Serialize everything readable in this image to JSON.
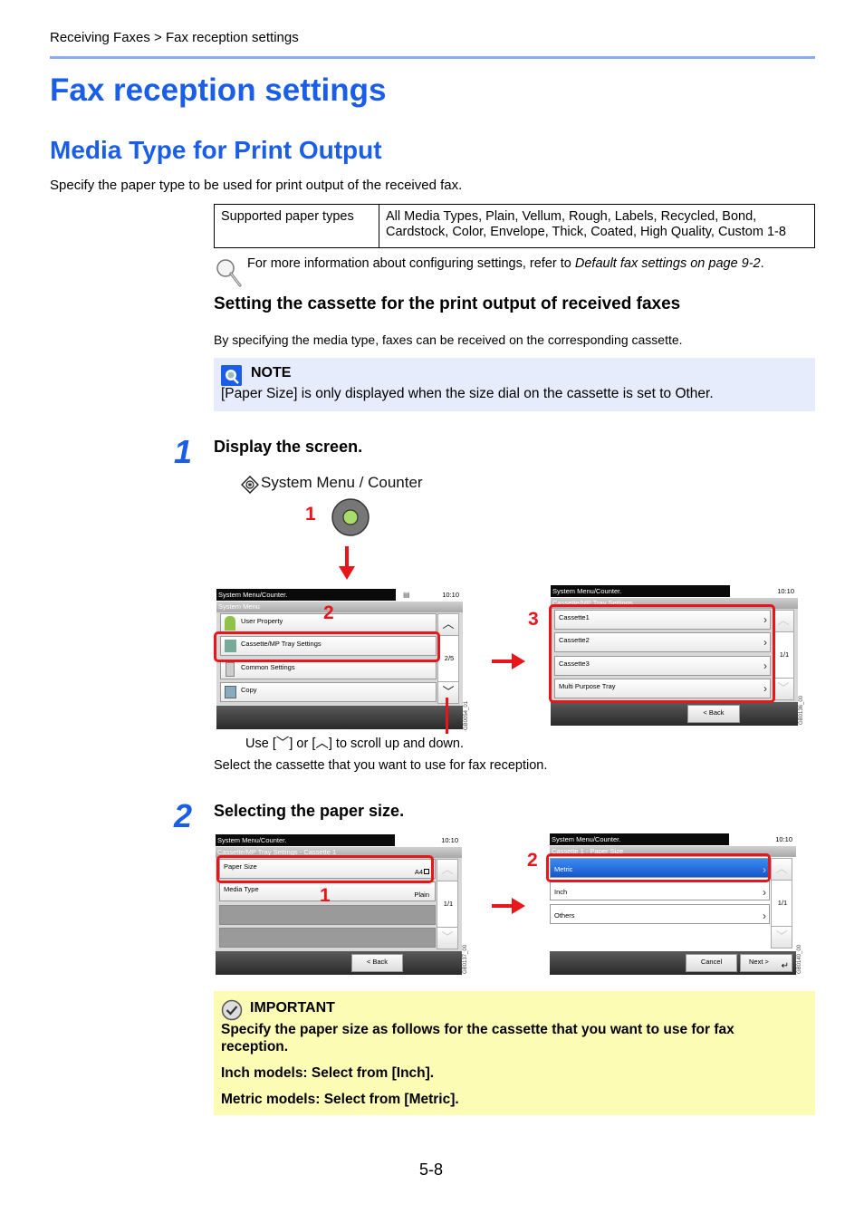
{
  "breadcrumb": "Receiving Faxes > Fax reception settings",
  "page_title": "Fax reception settings",
  "section_title": "Media Type for Print Output",
  "intro": "Specify the paper type to be used for print output of the received fax.",
  "spec_table": {
    "label": "Supported paper types",
    "value": "All Media Types, Plain, Vellum, Rough, Labels, Recycled, Bond, Cardstock, Color, Envelope, Thick, Coated, High Quality, Custom 1-8"
  },
  "reference": {
    "prefix": "For more information about configuring settings, refer to ",
    "link": "Default fax settings on page 9-2",
    "suffix": "."
  },
  "subsection_title": "Setting the cassette for the print output of received faxes",
  "subsection_intro": "By specifying the media type, faxes can be received on the corresponding cassette.",
  "note": {
    "title": "NOTE",
    "body": "[Paper Size] is only displayed when the size dial on the cassette is set to Other."
  },
  "steps": [
    {
      "number": "1",
      "heading": "Display the screen.",
      "key_label": "System Menu / Counter",
      "callouts": [
        "1",
        "2",
        "3"
      ],
      "scroll_caption": {
        "pre": "Use [",
        "mid": "] or [",
        "post": "] to scroll up and down."
      },
      "after_text": "Select the cassette that you want to use for fax reception.",
      "screen_a": {
        "header": "System Menu/Counter.",
        "time": "10:10",
        "subheader": "System Menu",
        "items": [
          "User Property",
          "Cassette/MP Tray Settings",
          "Common Settings",
          "Copy"
        ],
        "page": "2/5",
        "id": "GB0054_01"
      },
      "screen_b": {
        "header": "System Menu/Counter.",
        "time": "10:10",
        "subheader": "Cassette/MP Tray Settings",
        "items": [
          "Cassette1",
          "Cassette2",
          "Cassette3",
          "Multi Purpose Tray"
        ],
        "page": "1/1",
        "back": "< Back",
        "id": "GB0136_00"
      }
    },
    {
      "number": "2",
      "heading": "Selecting the paper size.",
      "callouts": [
        "1",
        "2"
      ],
      "screen_a": {
        "header": "System Menu/Counter.",
        "time": "10:10",
        "subheader": "Cassette/MP Tray Settings - Cassette 1",
        "items": [
          {
            "label": "Paper Size",
            "value": "A4"
          },
          {
            "label": "Media Type",
            "value": "Plain"
          }
        ],
        "page": "1/1",
        "back": "< Back",
        "id": "GB0137_00"
      },
      "screen_b": {
        "header": "System Menu/Counter.",
        "time": "10:10",
        "subheader": "Cassette 1 - Paper Size",
        "items": [
          "Metric",
          "Inch",
          "Others"
        ],
        "selected": "Metric",
        "page": "1/1",
        "cancel": "Cancel",
        "next": "Next >",
        "id": "GB0140_00"
      }
    }
  ],
  "important": {
    "title": "IMPORTANT",
    "lines": [
      "Specify the paper size as follows for the cassette that you want to use for fax reception.",
      "Inch models: Select from [Inch].",
      "Metric models: Select from [Metric]."
    ]
  },
  "page_number": "5-8",
  "colors": {
    "accent": "#1a5ee8",
    "callout": "#e8151b",
    "note_bg": "#e6ecfb",
    "important_bg": "#fdfcb4",
    "selected": "#1e6ae0"
  }
}
